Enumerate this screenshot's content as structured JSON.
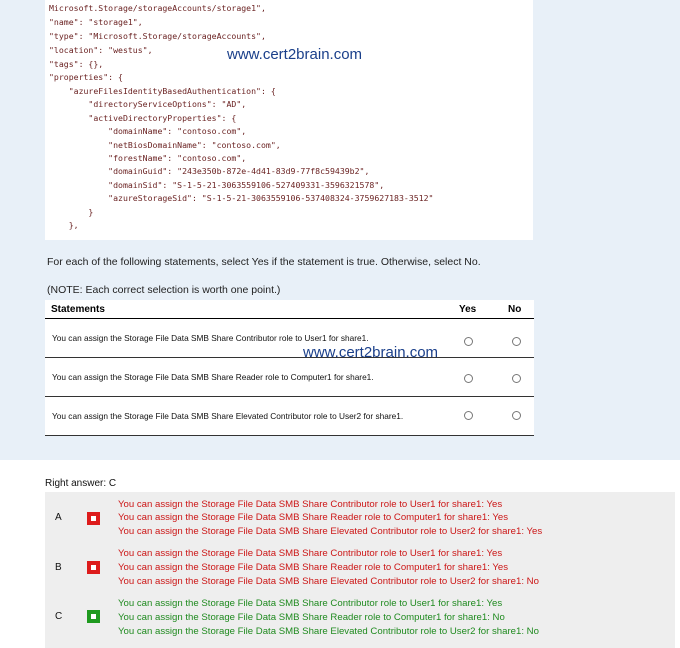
{
  "watermark": "www.cert2brain.com",
  "code_lines": [
    "Microsoft.Storage/storageAccounts/storage1\",",
    "\"name\": \"storage1\",",
    "\"type\": \"Microsoft.Storage/storageAccounts\",",
    "\"location\": \"westus\",",
    "\"tags\": {},",
    "\"properties\": {",
    "    \"azureFilesIdentityBasedAuthentication\": {",
    "        \"directoryServiceOptions\": \"AD\",",
    "        \"activeDirectoryProperties\": {",
    "            \"domainName\": \"contoso.com\",",
    "            \"netBiosDomainName\": \"contoso.com\",",
    "            \"forestName\": \"contoso.com\",",
    "            \"domainGuid\": \"243e350b-872e-4d41-83d9-77f8c59439b2\",",
    "            \"domainSid\": \"S-1-5-21-3063559106-527409331-3596321578\",",
    "            \"azureStorageSid\": \"S-1-5-21-3063559106-537408324-3759627183-3512\"",
    "        }",
    "    },"
  ],
  "instructions": "For each of the following statements, select Yes if the statement is true. Otherwise, select No.",
  "note": "(NOTE: Each correct selection is worth one point.)",
  "table": {
    "headers": {
      "statements": "Statements",
      "yes": "Yes",
      "no": "No"
    },
    "rows": [
      "You can assign the Storage File Data SMB Share Contributor role to User1 for share1.",
      "You can assign the Storage File Data SMB Share Reader role to Computer1 for share1.",
      "You can assign the Storage File Data SMB Share Elevated Contributor role to User2 for share1."
    ]
  },
  "right_answer_label": "Right answer:",
  "right_answer_value": "C",
  "options": [
    {
      "letter": "A",
      "status": "wrong",
      "lines": [
        {
          "text": "You can assign the Storage File Data SMB Share Contributor role to User1 for share1: ",
          "answer": "Yes"
        },
        {
          "text": "You can assign the Storage File Data SMB Share Reader role to Computer1 for share1: ",
          "answer": "Yes"
        },
        {
          "text": "You can assign the Storage File Data SMB Share Elevated Contributor role to User2 for share1: ",
          "answer": "Yes"
        }
      ]
    },
    {
      "letter": "B",
      "status": "wrong",
      "lines": [
        {
          "text": "You can assign the Storage File Data SMB Share Contributor role to User1 for share1: ",
          "answer": "Yes"
        },
        {
          "text": "You can assign the Storage File Data SMB Share Reader role to Computer1 for share1: ",
          "answer": "Yes"
        },
        {
          "text": "You can assign the Storage File Data SMB Share Elevated Contributor role to User2 for share1: ",
          "answer": "No"
        }
      ]
    },
    {
      "letter": "C",
      "status": "right",
      "lines": [
        {
          "text": "You can assign the Storage File Data SMB Share Contributor role to User1 for share1: ",
          "answer": "Yes"
        },
        {
          "text": "You can assign the Storage File Data SMB Share Reader role to Computer1 for share1: ",
          "answer": "No"
        },
        {
          "text": "You can assign the Storage File Data SMB Share Elevated Contributor role to User2 for share1: ",
          "answer": "No"
        }
      ]
    }
  ],
  "colors": {
    "wrong": "#dd1b1b",
    "right": "#1f9a1f",
    "panel": "#e8f0f8"
  }
}
